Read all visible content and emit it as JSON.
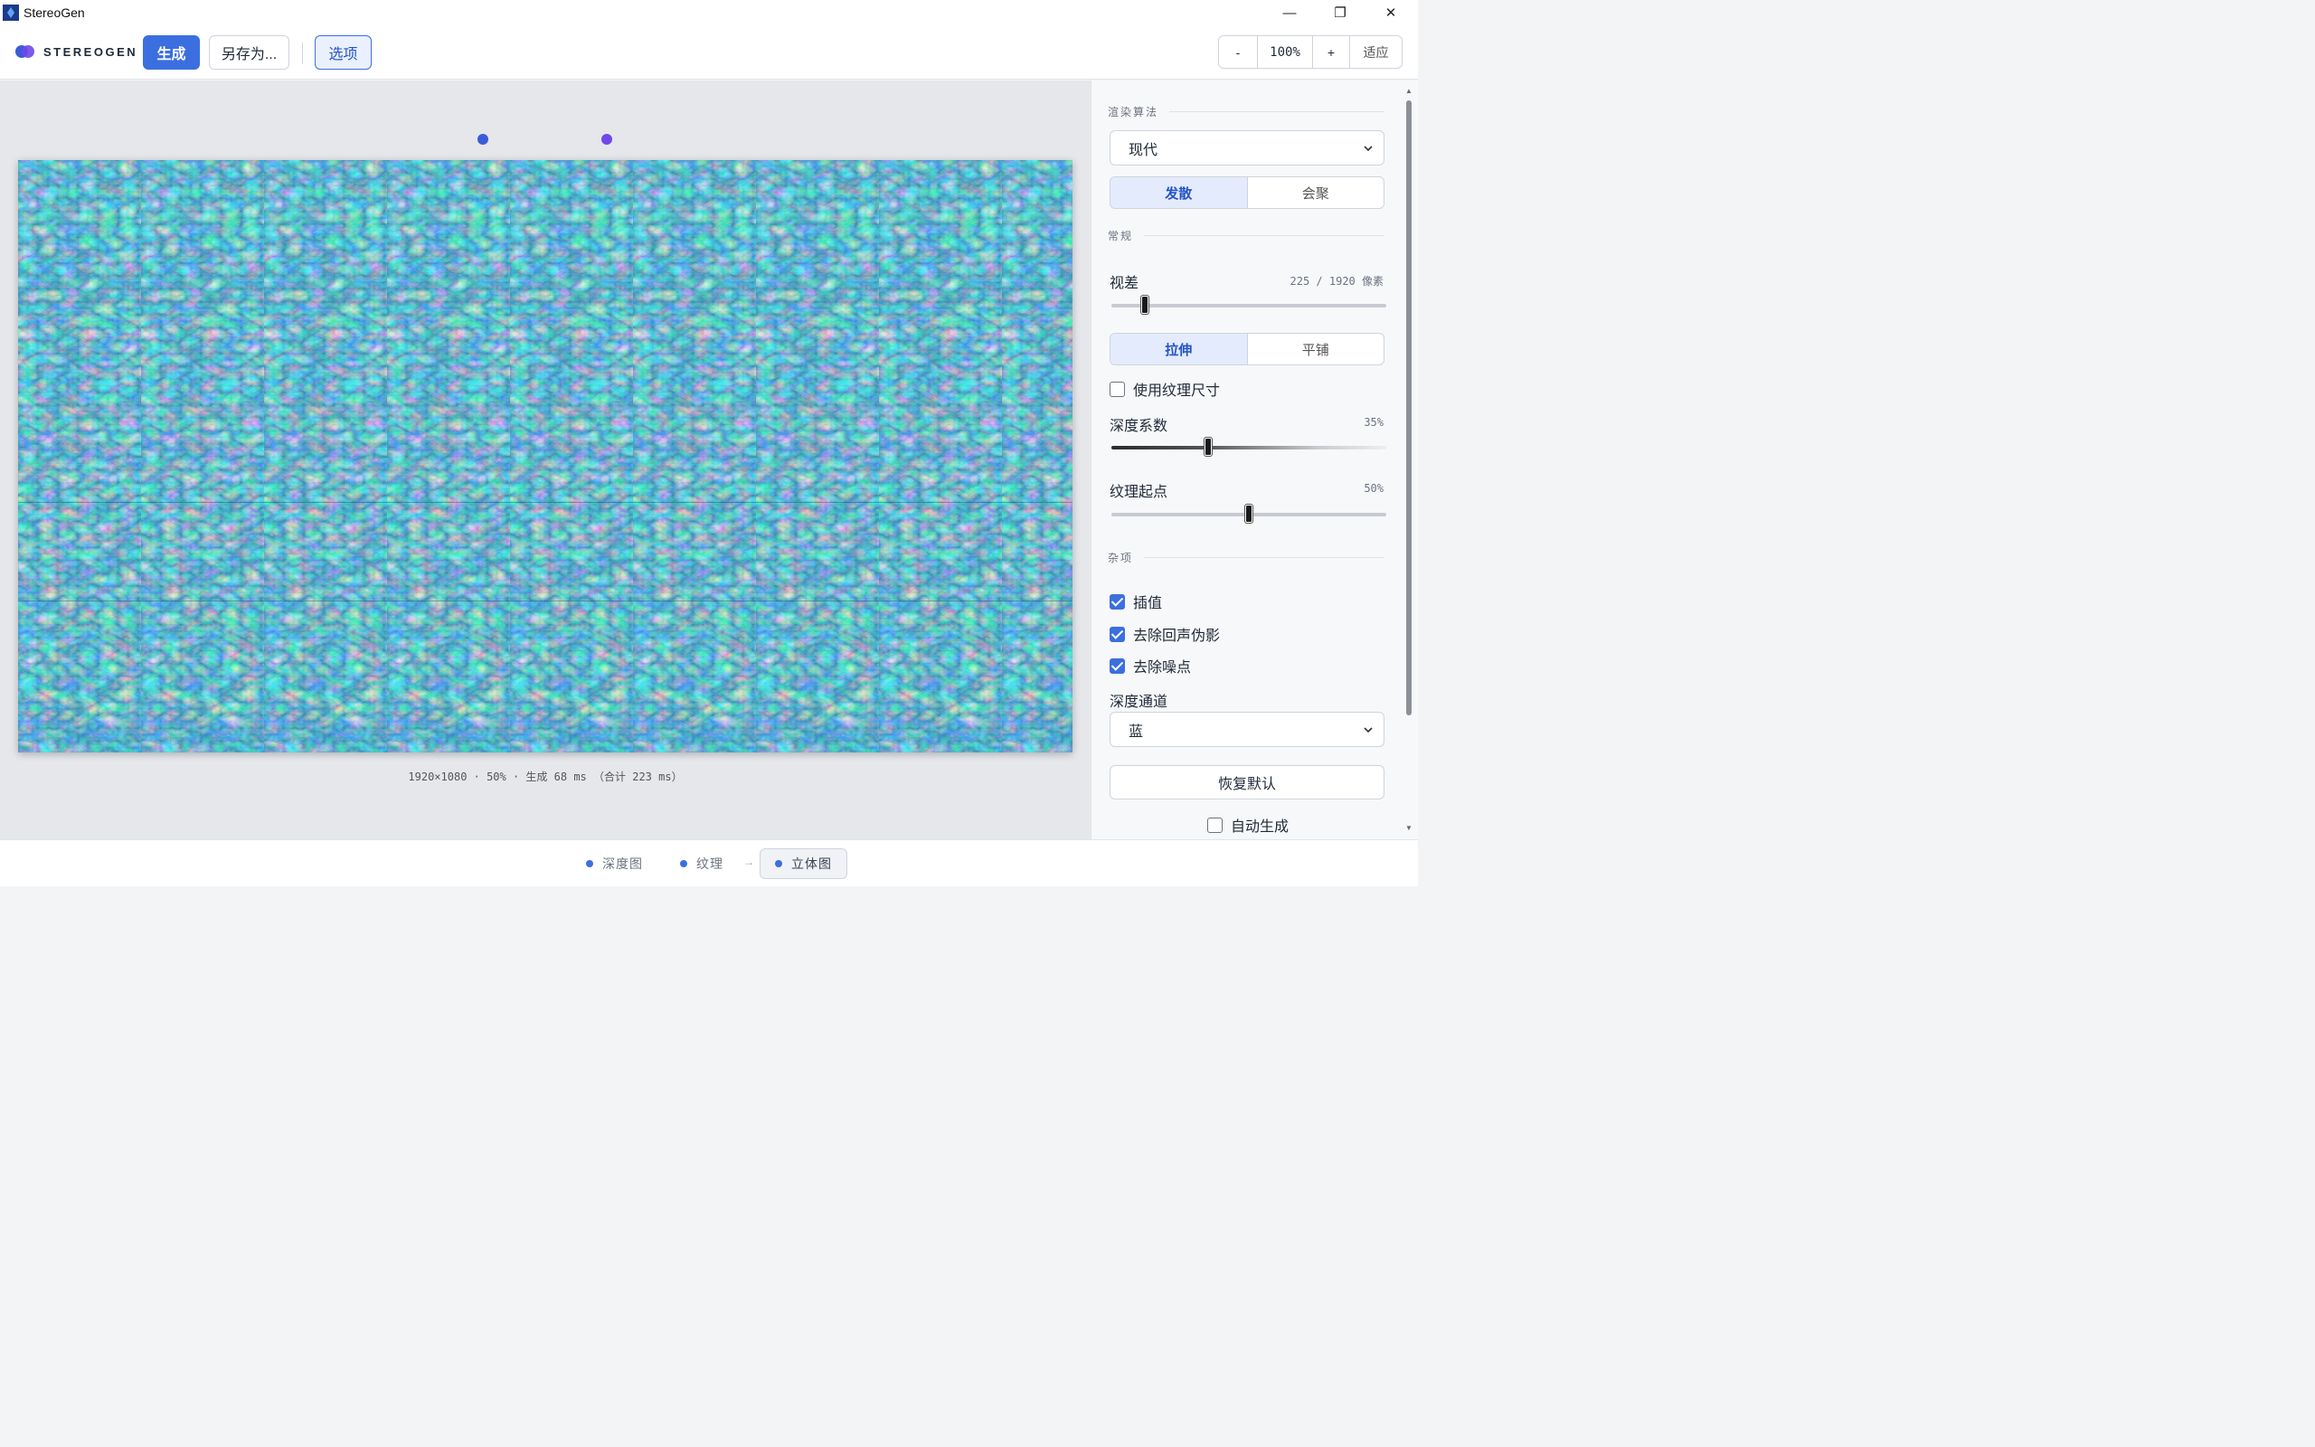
{
  "window": {
    "title": "StereoGen",
    "controls": {
      "minimize": "—",
      "restore": "❐",
      "close": "✕"
    }
  },
  "toolbar": {
    "brand": "STEREOGEN",
    "generate_label": "生成",
    "save_as_label": "另存为...",
    "options_label": "选项",
    "zoom_out_label": "-",
    "zoom_level": "100%",
    "zoom_in_label": "+",
    "fit_label": "适应"
  },
  "canvas": {
    "caption": "1920×1080 · 50% · 生成 68 ms （合计 223 ms）",
    "guide_dot_colors": [
      "#3b5bdb",
      "#7048e8"
    ]
  },
  "panel": {
    "render_section": "渲染算法",
    "algorithm_value": "现代",
    "mode_options": [
      "发散",
      "会聚"
    ],
    "mode_selected": "发散",
    "general_section": "常规",
    "parallax_label": "视差",
    "parallax_value": "225 / 1920 像素",
    "parallax_fraction": 0.117,
    "fit_options": [
      "拉伸",
      "平铺"
    ],
    "fit_selected": "拉伸",
    "use_texture_size_label": "使用纹理尺寸",
    "use_texture_size_checked": false,
    "depth_factor_label": "深度系数",
    "depth_factor_value": "35%",
    "texture_start_label": "纹理起点",
    "texture_start_value": "50%",
    "misc_section": "杂项",
    "interpolate_label": "插值",
    "interpolate_checked": true,
    "remove_echo_label": "去除回声伪影",
    "remove_echo_checked": true,
    "remove_noise_label": "去除噪点",
    "remove_noise_checked": true,
    "depth_channel_label": "深度通道",
    "depth_channel_value": "蓝",
    "reset_label": "恢复默认",
    "auto_generate_label": "自动生成",
    "auto_generate_checked": false
  },
  "bottombar": {
    "steps": [
      "深度图",
      "纹理",
      "立体图"
    ],
    "active_step": "立体图",
    "arrow": "→"
  },
  "colors": {
    "accent": "#3b6fe0",
    "texture_dark": "#0b4f6c",
    "texture_light": "#7fdfe6"
  }
}
